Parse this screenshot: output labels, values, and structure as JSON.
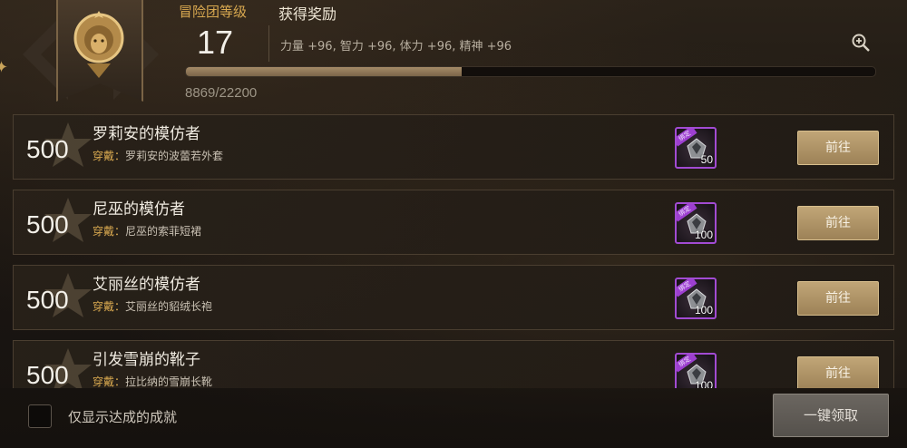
{
  "header": {
    "level_label": "冒险团等级",
    "level": "17",
    "reward_title": "获得奖励",
    "reward_text": "力量 +96, 智力 +96, 体力 +96, 精神 +96",
    "xp_text": "8869/22200",
    "xp_progress": 0.4
  },
  "achievements": [
    {
      "points": "500",
      "title": "罗莉安的模仿者",
      "sub_key": "穿戴：",
      "sub_value": "罗莉安的波蕾若外套",
      "item_tag": "绑定",
      "item_count": "50",
      "button": "前往"
    },
    {
      "points": "500",
      "title": "尼巫的模仿者",
      "sub_key": "穿戴：",
      "sub_value": "尼巫的索菲短裙",
      "item_tag": "绑定",
      "item_count": "100",
      "button": "前往"
    },
    {
      "points": "500",
      "title": "艾丽丝的模仿者",
      "sub_key": "穿戴：",
      "sub_value": "艾丽丝的貂绒长袍",
      "item_tag": "绑定",
      "item_count": "100",
      "button": "前往"
    },
    {
      "points": "500",
      "title": "引发雪崩的靴子",
      "sub_key": "穿戴：",
      "sub_value": "拉比纳的雪崩长靴",
      "item_tag": "绑定",
      "item_count": "100",
      "button": "前往"
    }
  ],
  "footer": {
    "filter_label": "仅显示达成的成就",
    "claim_all": "一键领取"
  },
  "icons": {
    "emblem": "lion-emblem-icon",
    "zoom": "zoom-in-icon",
    "row_star": "star-icon",
    "item": "item-icon"
  },
  "colors": {
    "accent_gold": "#d9a950",
    "item_border": "#a24bd3",
    "button": "#b39a6c"
  }
}
